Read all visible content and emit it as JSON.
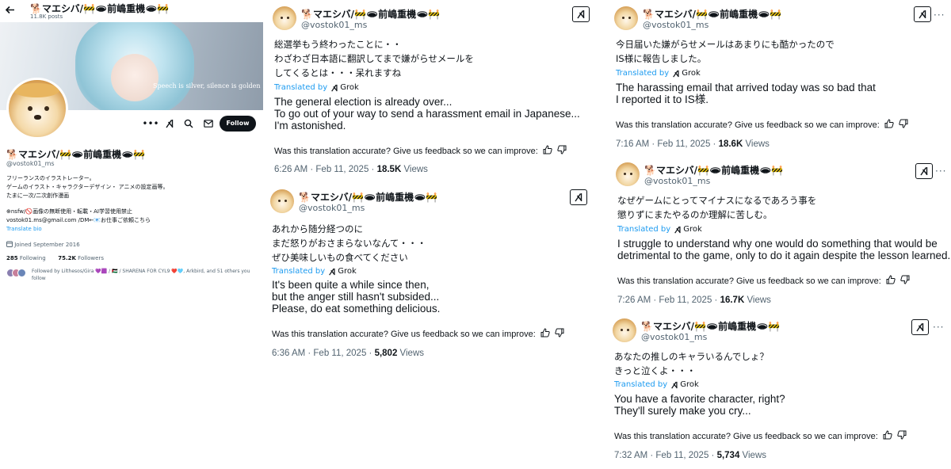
{
  "profile": {
    "name": "🐕マエシバ/🚧🕳前嶋重機🕳🚧",
    "posts": "11.8K posts",
    "banner_quote": "Speech is silver, silence is golden",
    "handle": "@vostok01_ms",
    "follow_label": "Follow",
    "bio_lines": [
      "フリーランスのイラストレーター。",
      "ゲームのイラスト・キャラクターデザイン・ アニメの設定画等。",
      "たまに一次/二次創作漫画",
      "",
      "⊕nsfw/🚫画像の無断使用・転載・AI学習使用禁止",
      "vostok01.ms@gmail.com /DM←📧お仕事ご依頼こちら"
    ],
    "translate_bio": "Translate bio",
    "joined": "Joined September 2016",
    "following_count": "285",
    "following_label": "Following",
    "followers_count": "75.2K",
    "followers_label": "Followers",
    "followed_by": "Followed by Lilthesos/Gira 💜🟪 / 🇵🇸 / SHARENA FOR CYL9 ❤️🩵, Arkbird, and 51 others you follow"
  },
  "translation": {
    "translated_by": "Translated by",
    "engine": "Grok",
    "feedback": "Was this translation accurate? Give us feedback so we can improve:"
  },
  "tweets": [
    {
      "name": "🐕マエシバ/🚧🕳前嶋重機🕳🚧",
      "handle": "@vostok01_ms",
      "jp": [
        "総選挙もう終わったことに・・",
        "わざわざ日本語に翻訳してまで嫌がらせメールを",
        "してくるとは・・・呆れますね"
      ],
      "en": [
        "The general election is already over...",
        "To go out of your way to send a harassment email in Japanese...",
        "I'm astonished."
      ],
      "time": "6:26 AM · Feb 11, 2025 · ",
      "views": "18.5K",
      "views_label": " Views"
    },
    {
      "name": "🐕マエシバ/🚧🕳前嶋重機🕳🚧",
      "handle": "@vostok01_ms",
      "jp": [
        "あれから随分経つのに",
        "まだ怒りがおさまらないなんて・・・",
        "ぜひ美味しいもの食べてください"
      ],
      "en": [
        "It's been quite a while since then,",
        "but the anger still hasn't subsided...",
        "Please, do eat something delicious."
      ],
      "time": "6:36 AM · Feb 11, 2025 · ",
      "views": "5,802",
      "views_label": " Views"
    },
    {
      "name": "🐕マエシバ/🚧🕳前嶋重機🕳🚧",
      "handle": "@vostok01_ms",
      "jp": [
        "今日届いた嫌がらせメールはあまりにも酷かったので",
        "IS様に報告しました。"
      ],
      "en": [
        "The harassing email that arrived today was so bad that",
        "I reported it to IS様."
      ],
      "time": "7:16 AM · Feb 11, 2025 · ",
      "views": "18.6K",
      "views_label": " Views"
    },
    {
      "name": "🐕マエシバ/🚧🕳前嶋重機🕳🚧",
      "handle": "@vostok01_ms",
      "jp": [
        "なぜゲームにとってマイナスになるであろう事を",
        "懲りずにまたやるのか理解に苦しむ。"
      ],
      "en": [
        "I struggle to understand why one would do something that would be",
        "detrimental to the game, only to do it again despite the lesson learned."
      ],
      "time": "7:26 AM · Feb 11, 2025 · ",
      "views": "16.7K",
      "views_label": " Views"
    },
    {
      "name": "🐕マエシバ/🚧🕳前嶋重機🕳🚧",
      "handle": "@vostok01_ms",
      "jp": [
        "あなたの推しのキャラいるんでしょ？",
        "きっと泣くよ・・・"
      ],
      "en": [
        "You have a favorite character, right?",
        "They'll surely make you cry..."
      ],
      "time": "7:32 AM · Feb 11, 2025 · ",
      "views": "5,734",
      "views_label": " Views"
    }
  ],
  "colors": {
    "link": "#1d9bf0",
    "text": "#0f1419",
    "muted": "#536471",
    "button": "#0f1419"
  },
  "icons": [
    "back-arrow-icon",
    "more-icon",
    "grok-icon",
    "search-icon",
    "mail-icon",
    "calendar-icon",
    "thumbs-up-icon",
    "thumbs-down-icon"
  ]
}
